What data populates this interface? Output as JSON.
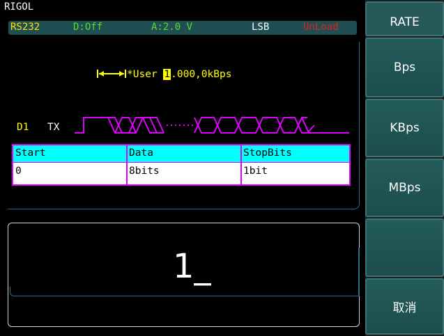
{
  "brand": "RIGOL",
  "status": {
    "interface": "RS232",
    "digital": "D:Off",
    "analog": "A:2.0 V",
    "bit_order": "LSB",
    "load": "UnLoad"
  },
  "rate_display": {
    "prefix": "*User ",
    "cursor_digit": "1",
    "value_rest": ".000,0kBps"
  },
  "channel": {
    "label": "D1",
    "line": "TX"
  },
  "frame_table": {
    "headers": [
      "Start",
      "Data",
      "StopBits"
    ],
    "values": [
      "0",
      "8bits",
      "1bit"
    ]
  },
  "entry": {
    "value": "1_"
  },
  "softkeys": [
    {
      "label": "RATE"
    },
    {
      "label": "Bps"
    },
    {
      "label": "KBps"
    },
    {
      "label": "MBps"
    },
    {
      "label": ""
    },
    {
      "label": "取消"
    }
  ],
  "colors": {
    "status_bg": "#1f4f52",
    "trace": "#e000ff",
    "highlight": "#ffff00",
    "table_header": "#00ffff",
    "softkey_bg": "#235c5a"
  }
}
